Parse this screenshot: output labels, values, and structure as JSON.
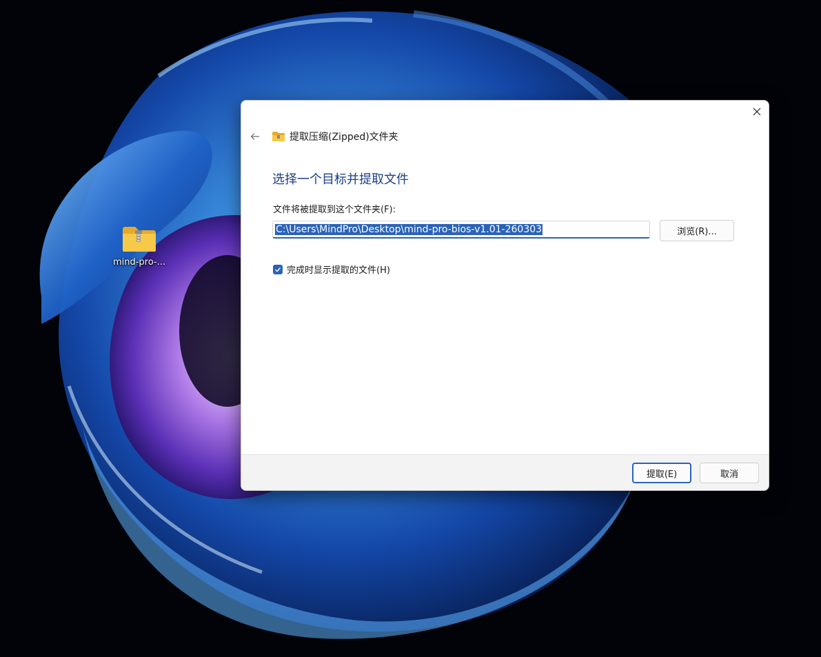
{
  "desktop": {
    "icon_label": "mind-pro-...",
    "icon": "zip-folder-icon"
  },
  "dialog": {
    "title": "提取压缩(Zipped)文件夹",
    "heading": "选择一个目标并提取文件",
    "path_label": "文件将被提取到这个文件夹(F):",
    "path_value": "C:\\Users\\MindPro\\Desktop\\mind-pro-bios-v1.01-260303",
    "browse_label": "浏览(R)...",
    "show_files_label": "完成时显示提取的文件(H)",
    "show_files_checked": true,
    "extract_label": "提取(E)",
    "cancel_label": "取消",
    "accent_color": "#2a63b8",
    "heading_color": "#1a3f86"
  }
}
